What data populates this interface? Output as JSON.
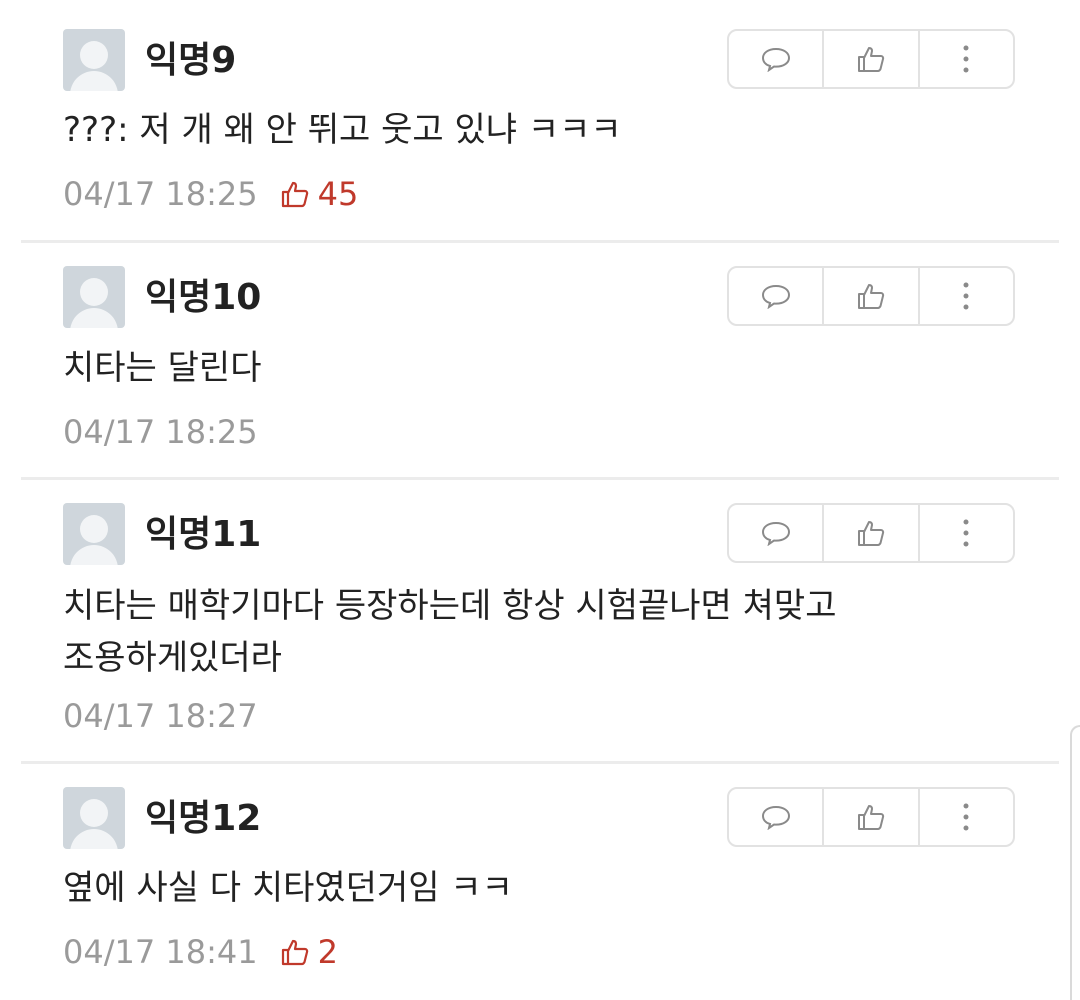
{
  "comments": [
    {
      "author": "익명9",
      "text": "???: 저 개 왜 안 뛰고 웃고 있냐 ㅋㅋㅋ",
      "time": "04/17 18:25",
      "likes": "45"
    },
    {
      "author": "익명10",
      "text": "치타는 달린다",
      "time": "04/17 18:25",
      "likes": ""
    },
    {
      "author": "익명11",
      "text": "치타는 매학기마다 등장하는데 항상 시험끝나면 쳐맞고\n조용하게있더라",
      "time": "04/17 18:27",
      "likes": ""
    },
    {
      "author": "익명12",
      "text": "옆에 사실 다 치타였던거임 ㅋㅋ",
      "time": "04/17 18:41",
      "likes": "2"
    }
  ],
  "icons": {
    "reply": "speech-bubble-icon",
    "vote": "thumbs-up-icon",
    "more": "vertical-dots-icon",
    "like_count": "thumbs-up-icon"
  },
  "colors": {
    "like": "#c0392b",
    "meta": "#9a9a9a",
    "avatar": "#cfd6dc",
    "border": "#e2e2e2"
  }
}
